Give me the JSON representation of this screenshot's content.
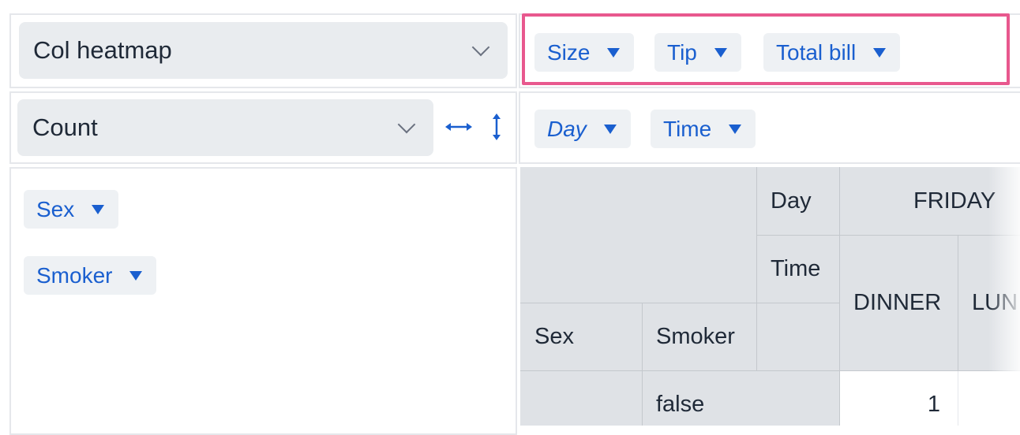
{
  "renderer_select": {
    "value": "Col heatmap"
  },
  "aggregator_select": {
    "value": "Count"
  },
  "icons": {
    "swap_horizontal": "horizontal-arrows-icon",
    "swap_vertical": "vertical-arrows-icon",
    "dropdown": "chevron-down-icon",
    "pill_menu": "triangle-down-icon"
  },
  "unused_attrs": [
    {
      "label": "Size"
    },
    {
      "label": "Tip"
    },
    {
      "label": "Total bill"
    }
  ],
  "col_attrs": [
    {
      "label": "Day"
    },
    {
      "label": "Time"
    }
  ],
  "row_attrs": [
    {
      "label": "Sex"
    },
    {
      "label": "Smoker"
    }
  ],
  "colors": {
    "accent": "#1a5fcf",
    "highlight": "#e8588e",
    "header_bg": "#dfe2e6"
  },
  "table": {
    "col_attr_labels": [
      "Day",
      "Time"
    ],
    "row_attr_labels": [
      "Sex",
      "Smoker"
    ],
    "day_header": "FRIDAY",
    "time_headers": [
      "DINNER",
      "LUN"
    ],
    "rows": [
      {
        "smoker": "false",
        "values": [
          "1"
        ]
      }
    ]
  }
}
